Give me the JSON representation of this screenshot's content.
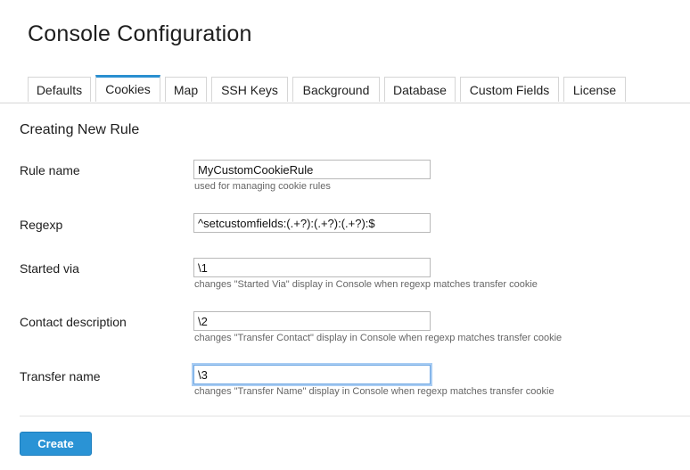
{
  "page_title": "Console Configuration",
  "tabs": [
    {
      "label": "Defaults",
      "active": false
    },
    {
      "label": "Cookies",
      "active": true
    },
    {
      "label": "Map",
      "active": false
    },
    {
      "label": "SSH Keys",
      "active": false
    },
    {
      "label": "Background",
      "active": false
    },
    {
      "label": "Database",
      "active": false
    },
    {
      "label": "Custom Fields",
      "active": false
    },
    {
      "label": "License",
      "active": false
    }
  ],
  "form": {
    "title": "Creating New Rule",
    "rule_name": {
      "label": "Rule name",
      "value": "MyCustomCookieRule",
      "help": "used for managing cookie rules"
    },
    "regexp": {
      "label": "Regexp",
      "value": "^setcustomfields:(.+?):(.+?):(.+?):$"
    },
    "started_via": {
      "label": "Started via",
      "value": "\\1",
      "help": "changes \"Started Via\" display in Console when regexp matches transfer cookie"
    },
    "contact_description": {
      "label": "Contact description",
      "value": "\\2",
      "help": "changes \"Transfer Contact\" display in Console when regexp matches transfer cookie"
    },
    "transfer_name": {
      "label": "Transfer name",
      "value": "\\3",
      "help": "changes \"Transfer Name\" display in Console when regexp matches transfer cookie"
    },
    "create_label": "Create"
  },
  "colors": {
    "accent": "#2a93d5",
    "tab_active_bar": "#2a8fd0",
    "focus_ring": "#a9cdf3"
  }
}
